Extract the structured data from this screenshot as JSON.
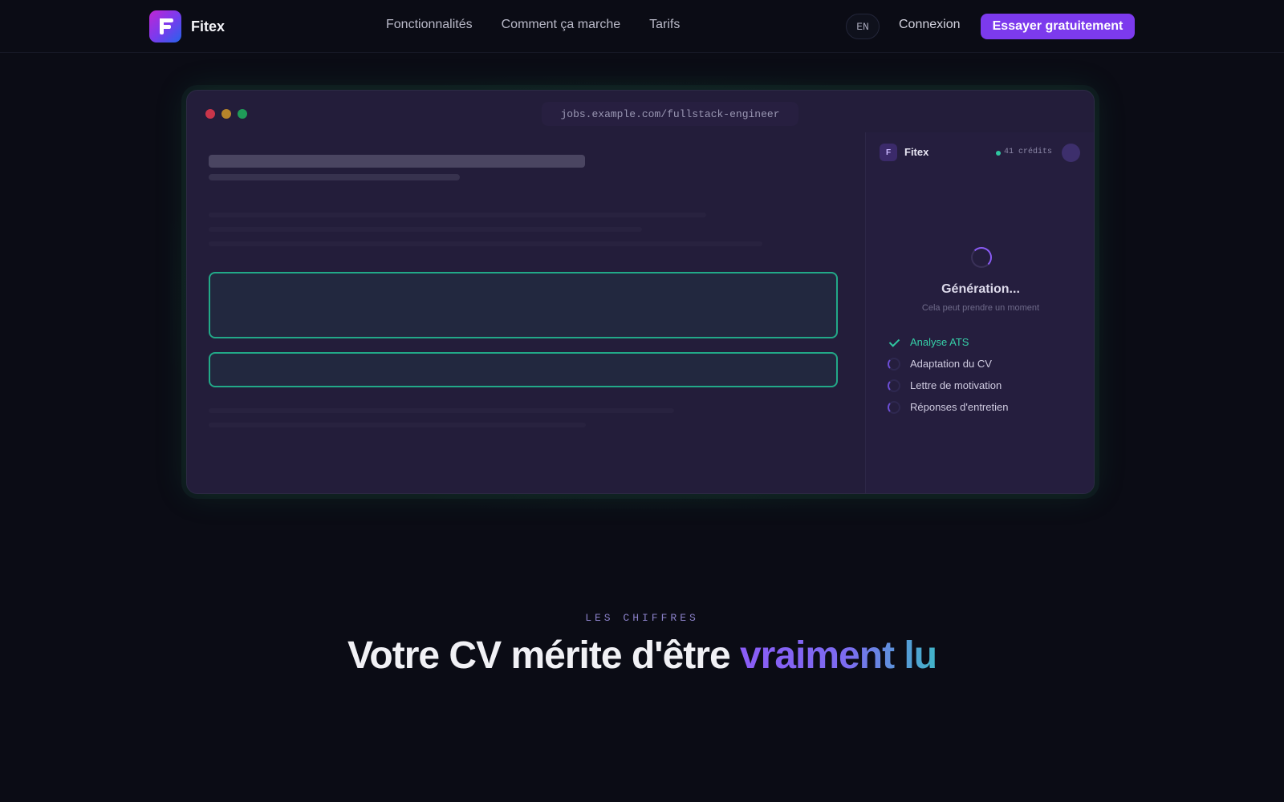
{
  "nav": {
    "brand": "Fitex",
    "links": [
      "Fonctionnalités",
      "Comment ça marche",
      "Tarifs"
    ],
    "lang": "EN",
    "login": "Connexion",
    "cta": "Essayer gratuitement"
  },
  "mockup": {
    "url": "jobs.example.com/fullstack-engineer",
    "panel": {
      "logo_letter": "F",
      "name": "Fitex",
      "credits": "41 crédits",
      "status_title": "Génération...",
      "status_sub": "Cela peut prendre un moment",
      "steps": [
        {
          "label": "Analyse ATS",
          "state": "done"
        },
        {
          "label": "Adaptation du CV",
          "state": "pending"
        },
        {
          "label": "Lettre de motivation",
          "state": "pending"
        },
        {
          "label": "Réponses d'entretien",
          "state": "pending"
        }
      ]
    }
  },
  "section": {
    "eyebrow": "LES CHIFFRES",
    "headline_main": "Votre CV mérite d'être ",
    "headline_accent": "vraiment lu"
  },
  "colors": {
    "background": "#0b0c15",
    "brand": "#7c3aed",
    "success": "#2fc6a0",
    "highlight": "#22a988"
  }
}
